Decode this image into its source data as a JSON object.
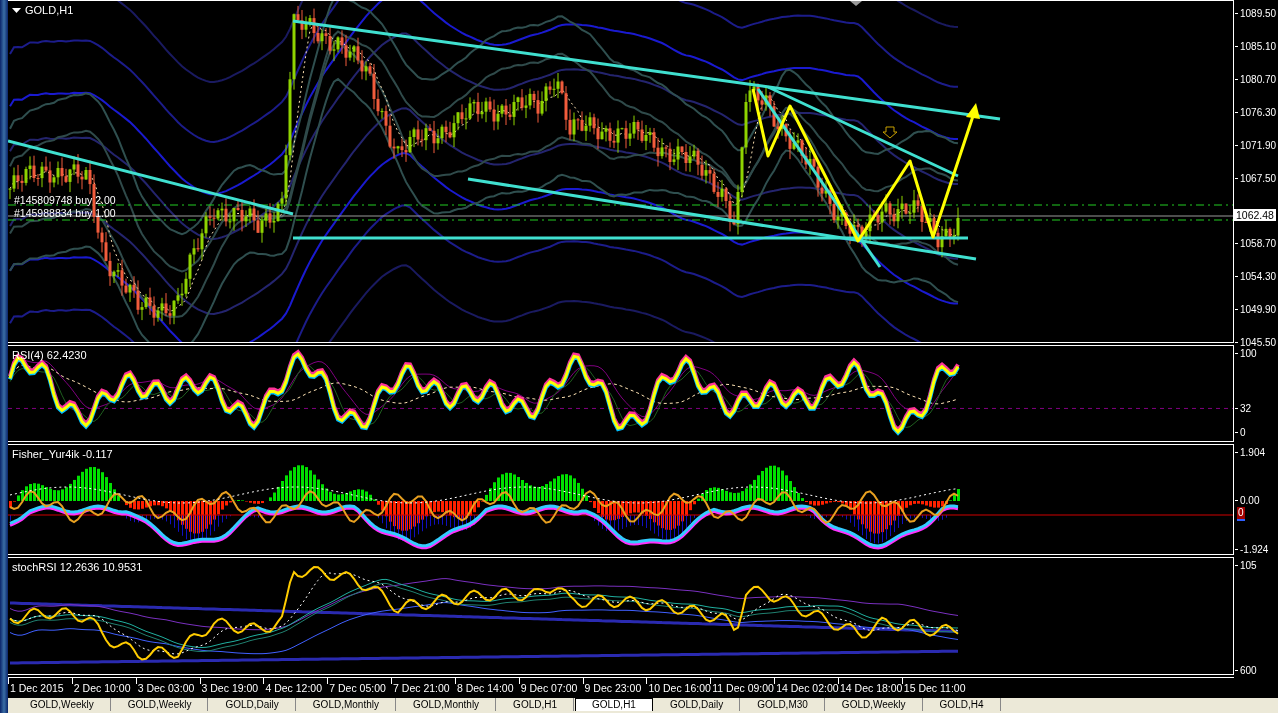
{
  "chart": {
    "title": "GOLD,H1",
    "price_axis": [
      "1089.50",
      "1085.10",
      "1080.70",
      "1076.30",
      "1071.90",
      "1067.50",
      "1058.70",
      "1054.30",
      "1049.90",
      "1045.50"
    ],
    "current_price": "1062.48",
    "orders": [
      "#145809748 buy 2.00",
      "#145988834 buy 1.00"
    ]
  },
  "indicators": [
    {
      "kind": "rsi",
      "label": "RSI(4) 62.4230",
      "axis": [
        "100",
        "32",
        "0"
      ]
    },
    {
      "kind": "fisher",
      "label": "Fisher_Yur4ik -0.117",
      "axis": [
        "1.904",
        "0.00",
        "-1.924"
      ],
      "marker": "0"
    },
    {
      "kind": "stoch",
      "label": "stochRSI 12.2636 10.9531",
      "axis": [
        "105",
        "600"
      ]
    }
  ],
  "time_axis": [
    "1 Dec 2015",
    "2 Dec 10:00",
    "3 Dec 03:00",
    "3 Dec 19:00",
    "4 Dec 12:00",
    "7 Dec 05:00",
    "7 Dec 21:00",
    "8 Dec 14:00",
    "9 Dec 07:00",
    "9 Dec 23:00",
    "10 Dec 16:00",
    "11 Dec 09:00",
    "14 Dec 02:00",
    "14 Dec 18:00",
    "15 Dec 11:00"
  ],
  "tabs": [
    {
      "label": "GOLD,Weekly",
      "selected": false
    },
    {
      "label": "GOLD,Weekly",
      "selected": false
    },
    {
      "label": "GOLD,Daily",
      "selected": false
    },
    {
      "label": "GOLD,Monthly",
      "selected": false
    },
    {
      "label": "GOLD,Monthly",
      "selected": false
    },
    {
      "label": "GOLD,H1",
      "selected": false
    },
    {
      "label": "GOLD,H1",
      "selected": true
    },
    {
      "label": "GOLD,Daily",
      "selected": false
    },
    {
      "label": "GOLD,M30",
      "selected": false
    },
    {
      "label": "GOLD,Weekly",
      "selected": false
    },
    {
      "label": "GOLD,H4",
      "selected": false
    }
  ]
}
